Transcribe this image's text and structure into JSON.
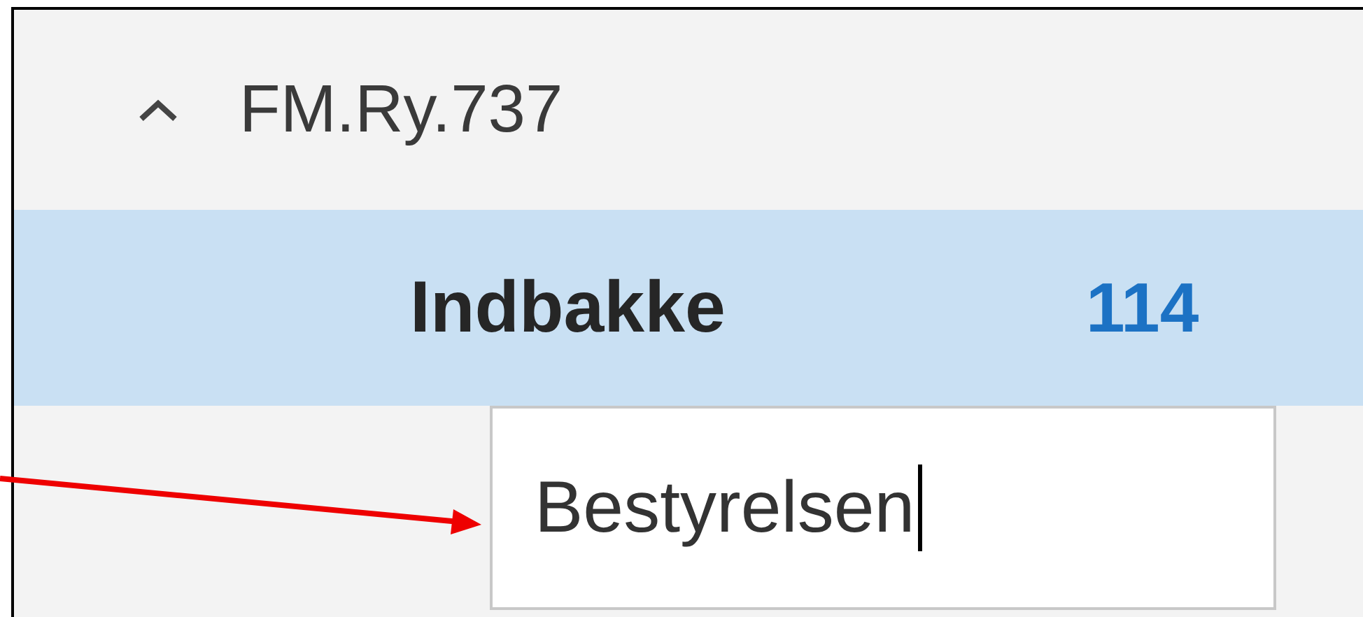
{
  "account": {
    "name": "FM.Ry.737",
    "expanded": true
  },
  "folders": [
    {
      "name": "Indbakke",
      "count": "114",
      "selected": true
    }
  ],
  "rename_field": {
    "value": "Bestyrelsen"
  }
}
